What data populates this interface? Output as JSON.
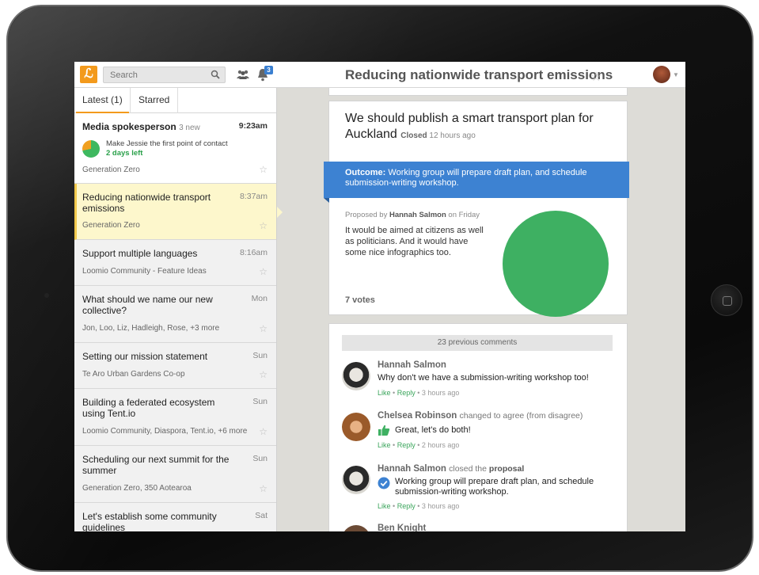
{
  "topbar": {
    "logo_glyph": "ℒ",
    "search_placeholder": "Search",
    "notifications_count": "3",
    "page_title": "Reducing nationwide transport emissions",
    "title_star": "☆"
  },
  "sidebar": {
    "tabs": [
      {
        "label": "Latest (1)"
      },
      {
        "label": "Starred"
      }
    ],
    "first_item": {
      "title": "Media spokesperson",
      "new_count": "3 new",
      "time": "9:23am",
      "deadline_text": "Make Jessie the first point of contact",
      "deadline_left": "2 days left",
      "group": "Generation Zero"
    },
    "items": [
      {
        "title": "Reducing nationwide transport emissions",
        "time": "8:37am",
        "group": "Generation Zero"
      },
      {
        "title": "Support multiple languages",
        "time": "8:16am",
        "group": "Loomio Community - Feature Ideas"
      },
      {
        "title": "What should we name our new collective?",
        "time": "Mon",
        "group": "Jon, Loo, Liz, Hadleigh, Rose, +3 more"
      },
      {
        "title": "Setting our mission statement",
        "time": "Sun",
        "group": "Te Aro Urban Gardens Co-op"
      },
      {
        "title": "Building a federated ecosystem using Tent.io",
        "time": "Sun",
        "group": "Loomio Community, Diaspora, Tent.io, +6 more"
      },
      {
        "title": "Scheduling our next summit for the summer",
        "time": "Sun",
        "group": "Generation Zero, 350 Aotearoa"
      },
      {
        "title": "Let's establish some community guidelines",
        "time": "Sat",
        "group": ""
      }
    ],
    "star_glyph": "☆"
  },
  "proposal": {
    "title": "We should publish a smart transport plan for Auckland",
    "status": "Closed",
    "status_time": "12 hours ago",
    "outcome_label": "Outcome:",
    "outcome_text": "Working group will prepare draft plan, and schedule submission-writing workshop.",
    "proposed_by_prefix": "Proposed by",
    "proposed_by_name": "Hannah Salmon",
    "proposed_by_when": "on Friday",
    "description": "It would be aimed at citizens as well as politicians. And it would have some nice infographics too.",
    "votes": "7 votes",
    "agree_color": "#3eb062"
  },
  "comments": {
    "previous": "23 previous comments",
    "like": "Like",
    "reply": "Reply",
    "sep": "•",
    "list": [
      {
        "name": "Hannah Salmon",
        "action": "",
        "action_bold": "",
        "body": "Why don't we have a submission-writing workshop too!",
        "time": "3 hours ago"
      },
      {
        "name": "Chelsea Robinson",
        "action": "changed to agree (from disagree)",
        "action_bold": "",
        "body": "Great, let's do both!",
        "time": "2 hours ago"
      },
      {
        "name": "Hannah Salmon",
        "action": "closed the",
        "action_bold": "proposal",
        "body": "Working group will prepare draft plan, and schedule submission-writing workshop.",
        "time": "3 hours ago"
      },
      {
        "name": "Ben Knight",
        "action": "",
        "action_bold": "",
        "body": "",
        "time": ""
      }
    ]
  },
  "colors": {
    "brand_orange": "#f39a1c",
    "outcome_blue": "#3d82d2",
    "like_green": "#3ba55c",
    "selected_bg": "#fdf7cc"
  }
}
